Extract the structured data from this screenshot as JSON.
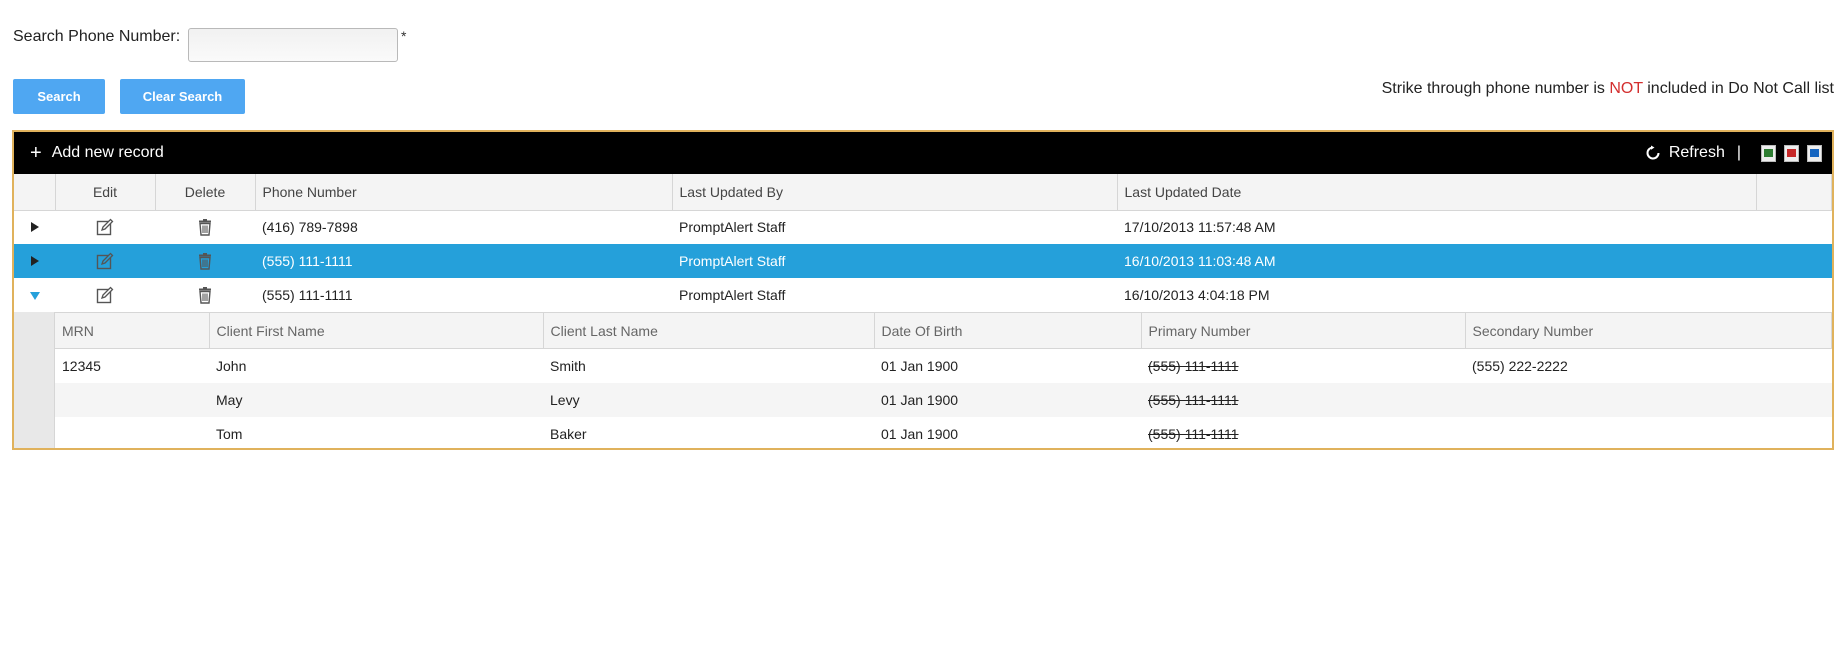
{
  "search": {
    "label": "Search Phone Number:",
    "placeholder": "",
    "value": "",
    "required_marker": "*",
    "search_button": "Search",
    "clear_button": "Clear Search"
  },
  "note": {
    "prefix": "Strike through phone number is ",
    "highlight": "NOT",
    "suffix": " included in Do Not Call list",
    "highlight_color": "#d32f2f"
  },
  "colors": {
    "button": "#4fa7f2",
    "selected_row": "#25a0da",
    "grid_border": "#e0b25c",
    "toolbar": "#000000"
  },
  "toolbar": {
    "add_label": "Add new record",
    "refresh_label": "Refresh",
    "separator": "|",
    "export_icons": [
      "excel-export-icon",
      "pdf-export-icon",
      "word-export-icon"
    ]
  },
  "grid": {
    "columns": [
      "Edit",
      "Delete",
      "Phone Number",
      "Last Updated By",
      "Last Updated Date"
    ],
    "rows": [
      {
        "phone": "(416) 789-7898",
        "updated_by": "PromptAlert Staff",
        "updated_date": "17/10/2013 11:57:48 AM",
        "state": "collapsed",
        "selected": false
      },
      {
        "phone": "(555) 111-1111",
        "updated_by": "PromptAlert Staff",
        "updated_date": "16/10/2013 11:03:48 AM",
        "state": "collapsed",
        "selected": true
      },
      {
        "phone": "(555) 111-1111",
        "updated_by": "PromptAlert Staff",
        "updated_date": "16/10/2013 4:04:18 PM",
        "state": "expanded",
        "selected": false
      }
    ]
  },
  "detail": {
    "columns": [
      "MRN",
      "Client First Name",
      "Client Last Name",
      "Date Of Birth",
      "Primary Number",
      "Secondary Number"
    ],
    "rows": [
      {
        "mrn": "12345",
        "first": "John",
        "last": "Smith",
        "dob": "01 Jan 1900",
        "primary": "(555) 111-1111",
        "primary_strike": true,
        "secondary": "(555) 222-2222"
      },
      {
        "mrn": "",
        "first": "May",
        "last": "Levy",
        "dob": "01 Jan 1900",
        "primary": "(555) 111-1111",
        "primary_strike": true,
        "secondary": ""
      },
      {
        "mrn": "",
        "first": "Tom",
        "last": "Baker",
        "dob": "01 Jan 1900",
        "primary": "(555) 111-1111",
        "primary_strike": true,
        "secondary": ""
      }
    ]
  }
}
